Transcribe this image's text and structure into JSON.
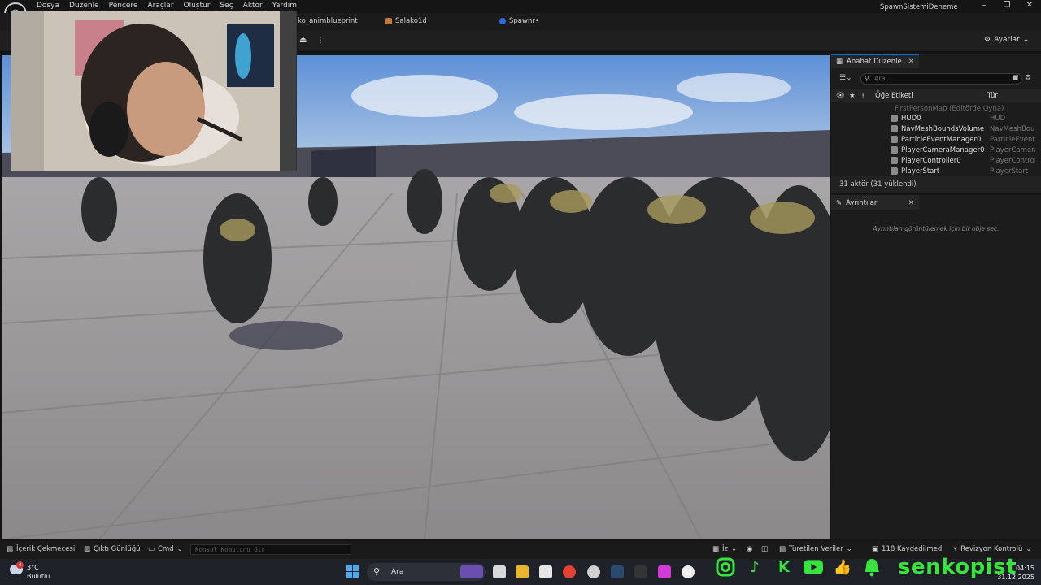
{
  "menu": [
    "Dosya",
    "Düzenle",
    "Pencere",
    "Araçlar",
    "Oluştur",
    "Seç",
    "Aktör",
    "Yardım"
  ],
  "window_title": "SpawnSistemiDeneme",
  "window_buttons": {
    "minimize": "–",
    "restore": "❐",
    "close": "✕"
  },
  "tabs": [
    {
      "label": "ko_animblueprint",
      "color": "#3b6fd8"
    },
    {
      "label": "Salako1d",
      "color": "#c07a35"
    },
    {
      "label": "Spawnr•",
      "color": "#2f6be0"
    }
  ],
  "toolbar": {
    "settings_label": "Ayarlar",
    "settings_icon": "gear-icon",
    "separator": "⋮"
  },
  "outliner": {
    "tab_label": "Anahat Düzenle...",
    "search_placeholder": "Ara...",
    "col_label": "Öğe Etiketi",
    "col_type": "Tür",
    "map_row": "FirstPersonMap (Editörde Oyna)",
    "rows": [
      {
        "label": "HUD0",
        "type": "HUD"
      },
      {
        "label": "NavMeshBoundsVolume",
        "type": "NavMeshBou"
      },
      {
        "label": "ParticleEventManager0",
        "type": "ParticleEvent"
      },
      {
        "label": "PlayerCameraManager0",
        "type": "PlayerCamera"
      },
      {
        "label": "PlayerController0",
        "type": "PlayerControll"
      },
      {
        "label": "PlayerStart",
        "type": "PlayerStart"
      }
    ],
    "count": "31 aktör (31 yüklendi)"
  },
  "details": {
    "tab_label": "Ayrıntılar",
    "empty_message": "Ayrıntıları görüntülemek için bir obje seç."
  },
  "statusbar": {
    "content_drawer": "İçerik Çekmecesi",
    "output_log": "Çıktı Günlüğü",
    "cmd": "Cmd",
    "console_placeholder": "Konsol Komutunu Gir",
    "iz": "İz",
    "derived_data": "Türetilen Veriler",
    "saved": "118 Kaydedilmedi",
    "revision": "Revizyon Kontrolü"
  },
  "taskbar": {
    "temperature": "3°C",
    "weather": "Bulutlu",
    "weather_badge": "4",
    "search_label": "Ara",
    "time": "04:15",
    "date": "31.12.2025"
  },
  "social": {
    "icons": [
      "instagram-icon",
      "tiktok-icon",
      "kick-icon",
      "youtube-icon",
      "thumbs-up-icon",
      "bell-icon"
    ],
    "handle": "senkopist"
  }
}
